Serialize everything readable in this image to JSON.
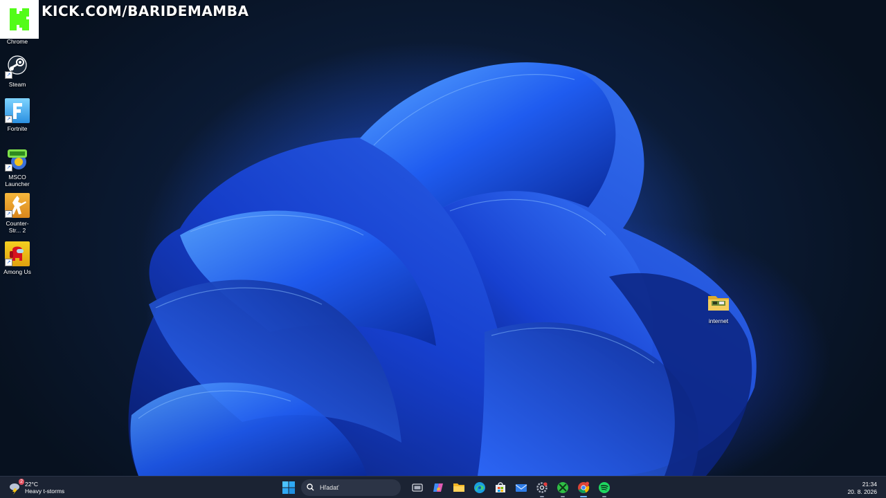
{
  "overlay": {
    "channel_text": "KICK.COM/BARIDEMAMBA"
  },
  "desktop_icons": [
    {
      "label": "Chrome",
      "icon": "chrome-icon"
    },
    {
      "label": "Steam",
      "icon": "steam-icon"
    },
    {
      "label": "Fortnite",
      "icon": "fortnite-icon"
    },
    {
      "label": "MSCO Launcher",
      "icon": "msco-launcher-icon"
    },
    {
      "label": "Counter-Str... 2",
      "icon": "counter-strike-icon"
    },
    {
      "label": "Among Us",
      "icon": "among-us-icon"
    },
    {
      "label": "internet",
      "icon": "folder-icon"
    }
  ],
  "taskbar": {
    "weather": {
      "temperature": "22°C",
      "condition": "Heavy t-storms",
      "alert_count": "2"
    },
    "search_placeholder": "Hľadať",
    "pinned_apps": [
      "start-icon",
      "task-view-icon",
      "copilot-icon",
      "file-explorer-icon",
      "edge-icon",
      "microsoft-store-icon",
      "mail-icon",
      "settings-icon",
      "xbox-icon",
      "chrome-icon",
      "spotify-icon"
    ],
    "clock": {
      "time": "21:34",
      "date": "20. 8. 2026"
    }
  },
  "colors": {
    "accent": "#53fc18",
    "taskbar_bg": "#1b2333",
    "wallpaper_blue": "#1f4fe0"
  }
}
